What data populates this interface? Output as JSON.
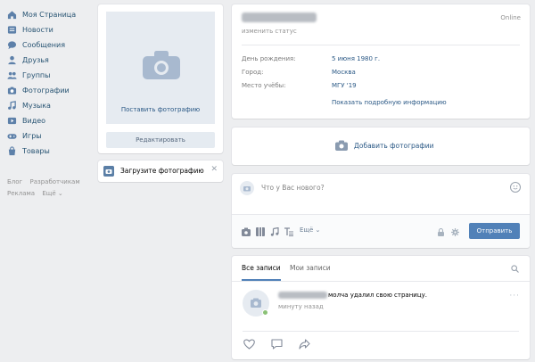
{
  "sidebar": {
    "items": [
      {
        "label": "Моя Страница",
        "icon": "home-icon"
      },
      {
        "label": "Новости",
        "icon": "news-icon"
      },
      {
        "label": "Сообщения",
        "icon": "messages-icon"
      },
      {
        "label": "Друзья",
        "icon": "friends-icon"
      },
      {
        "label": "Группы",
        "icon": "groups-icon"
      },
      {
        "label": "Фотографии",
        "icon": "photos-icon"
      },
      {
        "label": "Музыка",
        "icon": "music-icon"
      },
      {
        "label": "Видео",
        "icon": "video-icon"
      },
      {
        "label": "Игры",
        "icon": "games-icon"
      },
      {
        "label": "Товары",
        "icon": "market-icon"
      }
    ],
    "footer": {
      "blog": "Блог",
      "developers": "Разработчикам",
      "ads": "Реклама",
      "more": "Ещё ⌄"
    }
  },
  "avatar": {
    "set_photo": "Поставить фотографию",
    "edit": "Редактировать"
  },
  "upload": {
    "label": "Загрузите фотографию",
    "close": "✕"
  },
  "profile": {
    "online": "Online",
    "status": "изменить статус",
    "birthday_label": "День рождения:",
    "birthday_value": "5 июня 1980 г.",
    "city_label": "Город:",
    "city_value": "Москва",
    "study_label": "Место учёбы:",
    "study_value": "МГУ '19",
    "show_more": "Показать подробную информацию"
  },
  "add_photos": {
    "label": "Добавить фотографии"
  },
  "post": {
    "placeholder": "Что у Вас нового?",
    "more": "Ещё ⌄",
    "send": "Отправить"
  },
  "wall": {
    "tab_all": "Все записи",
    "tab_mine": "Мои записи",
    "entry_text": "молча удалил свою страницу.",
    "entry_time": "минуту назад",
    "dots": "···"
  },
  "colors": {
    "accent": "#5181b8",
    "link": "#2a5885",
    "background": "#edeef0"
  }
}
